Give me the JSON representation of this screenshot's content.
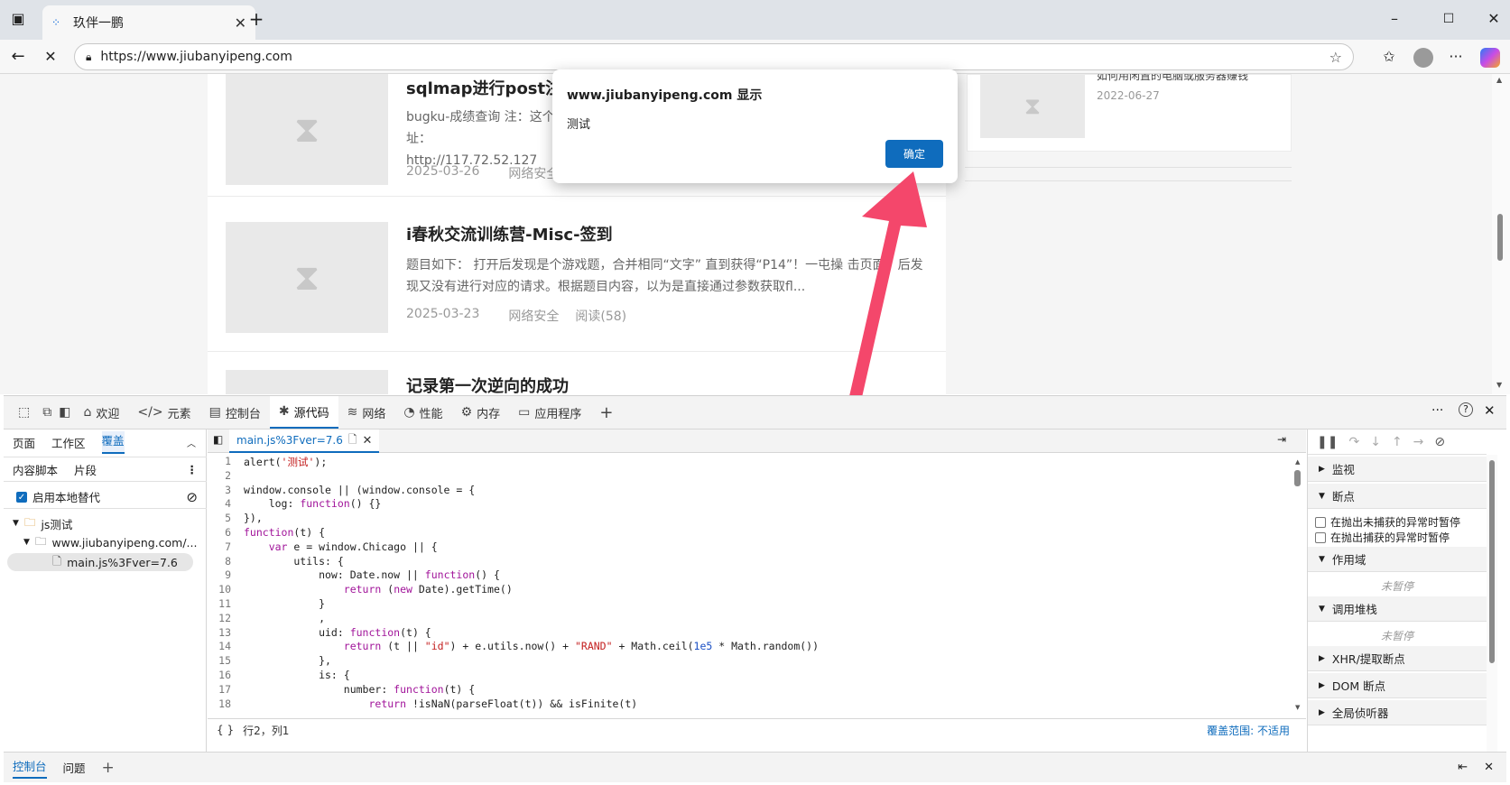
{
  "browser": {
    "tab_title": "玖伴一鹏",
    "url": "https://www.jiubanyipeng.com"
  },
  "page": {
    "posts": [
      {
        "title": "sqlmap进行post注",
        "desc": "bugku-成绩查询 注：这个 址：http://117.72.52.127",
        "date": "2025-03-26",
        "category": "网络安全",
        "views": ""
      },
      {
        "title": "i春秋交流训练营-Misc-签到",
        "desc": "题目如下： 打开后发现是个游戏题，合并相同“文字” 直到获得“P14”！一屯操   击页面，后发现又没有进行对应的请求。根据题目内容，以为是直接通过参数获取fl...",
        "date": "2025-03-23",
        "category": "网络安全",
        "views": "阅读(58)"
      },
      {
        "title": "记录第一次逆向的成功"
      }
    ],
    "side_card": {
      "title": "如何用闲置的电脑或服务器赚钱",
      "date": "2022-06-27"
    }
  },
  "dialog": {
    "title": "www.jiubanyipeng.com 显示",
    "message": "测试",
    "ok_label": "确定"
  },
  "devtools": {
    "tabs": [
      {
        "label": "欢迎",
        "icon": "home-icon"
      },
      {
        "label": "元素",
        "icon": "code-icon"
      },
      {
        "label": "控制台",
        "icon": "console-icon"
      },
      {
        "label": "源代码",
        "icon": "bug-icon"
      },
      {
        "label": "网络",
        "icon": "wifi-icon"
      },
      {
        "label": "性能",
        "icon": "gauge-icon"
      },
      {
        "label": "内存",
        "icon": "memory-icon"
      },
      {
        "label": "应用程序",
        "icon": "app-icon"
      }
    ],
    "left": {
      "tabs": [
        "页面",
        "工作区",
        "覆盖"
      ],
      "subtabs": [
        "内容脚本",
        "片段"
      ],
      "enable_overrides": "启用本地替代",
      "tree": [
        "js测试",
        "www.jiubanyipeng.com/...",
        "main.js%3Fver=7.6"
      ]
    },
    "editor": {
      "file_tab": "main.js%3Fver=7.6",
      "status_position": "行2，列1",
      "coverage": "覆盖范围: 不适用",
      "lines": [
        "alert('测试');",
        "",
        "window.console || (window.console = {",
        "    log: function() {}",
        "}),",
        "function(t) {",
        "    var e = window.Chicago || {",
        "        utils: {",
        "            now: Date.now || function() {",
        "                return (new Date).getTime()",
        "            }",
        "            ,",
        "            uid: function(t) {",
        "                return (t || \"id\") + e.utils.now() + \"RAND\" + Math.ceil(1e5 * Math.random())",
        "            },",
        "            is: {",
        "                number: function(t) {",
        "                    return !isNaN(parseFloat(t)) && isFinite(t)"
      ]
    },
    "right": {
      "watch": "监视",
      "breakpoints": "断点",
      "pause_uncaught": "在抛出未捕获的异常时暂停",
      "pause_caught": "在抛出捕获的异常时暂停",
      "scope": "作用域",
      "not_paused_1": "未暂停",
      "call_stack": "调用堆栈",
      "not_paused_2": "未暂停",
      "xhr": "XHR/提取断点",
      "dom": "DOM 断点",
      "global": "全局侦听器"
    },
    "drawer": [
      "控制台",
      "问题"
    ]
  }
}
